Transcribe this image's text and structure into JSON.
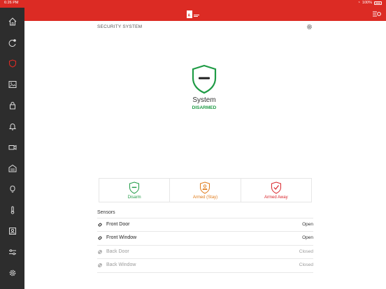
{
  "status_bar": {
    "time": "6:26 PM",
    "battery": "100%"
  },
  "colors": {
    "brand_red": "#dc2b24",
    "sidebar": "#2d2d2d",
    "green": "#1f9b45",
    "orange": "#e07b1a",
    "red": "#d9262c",
    "gray": "#9a9a9a"
  },
  "sidebar": {
    "items": [
      {
        "icon": "home-icon"
      },
      {
        "icon": "automation-icon"
      },
      {
        "icon": "shield-icon",
        "active": true
      },
      {
        "icon": "image-icon"
      },
      {
        "icon": "lock-icon"
      },
      {
        "icon": "bell-icon"
      },
      {
        "icon": "camera-icon"
      },
      {
        "icon": "garage-icon"
      },
      {
        "icon": "bulb-icon"
      },
      {
        "icon": "thermostat-icon"
      },
      {
        "icon": "contact-icon"
      },
      {
        "icon": "sliders-icon"
      },
      {
        "icon": "gear-icon"
      }
    ]
  },
  "main": {
    "title": "SECURITY SYSTEM",
    "system_label": "System",
    "system_state": "DISARMED"
  },
  "modes": [
    {
      "label": "Disarm",
      "color": "#1f9b45"
    },
    {
      "label": "Armed (Stay)",
      "color": "#e07b1a"
    },
    {
      "label": "Armed Away",
      "color": "#d9262c"
    }
  ],
  "sensors": {
    "title": "Sensors",
    "items": [
      {
        "name": "Front Door",
        "state": "Open",
        "active": true
      },
      {
        "name": "Front Window",
        "state": "Open",
        "active": true
      },
      {
        "name": "Back Door",
        "state": "Closed",
        "active": false
      },
      {
        "name": "Back Window",
        "state": "Closed",
        "active": false
      }
    ]
  }
}
